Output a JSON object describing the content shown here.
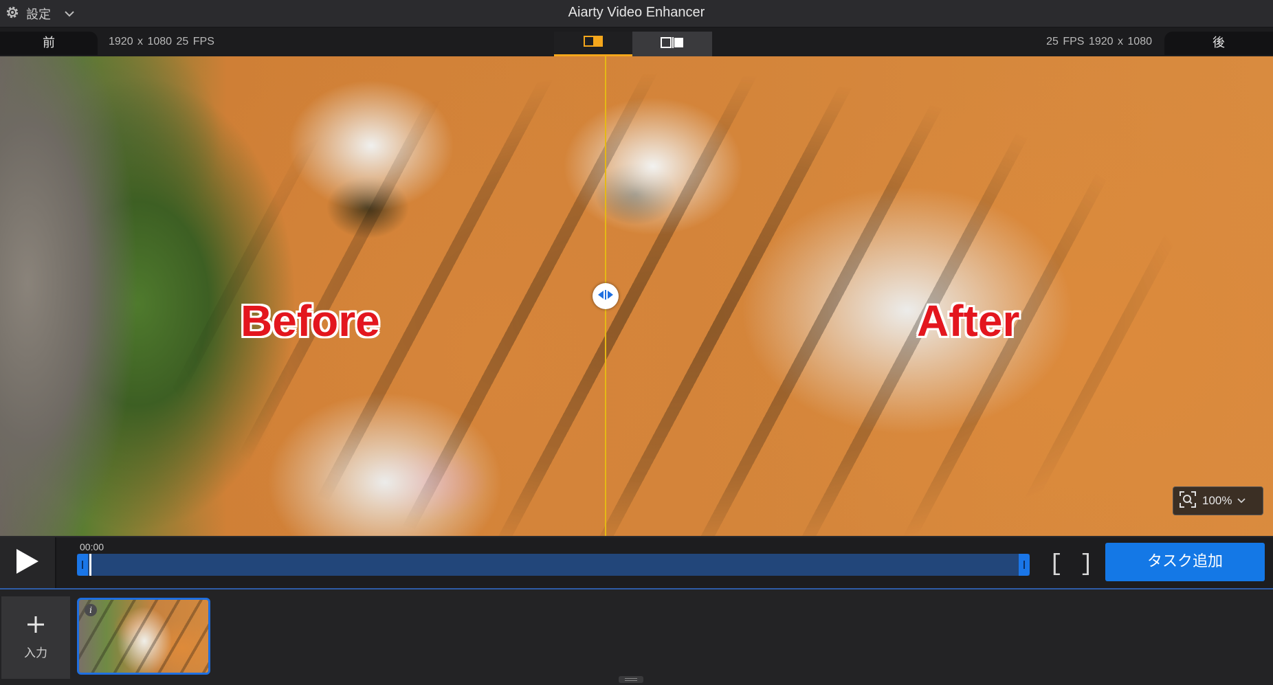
{
  "titlebar": {
    "settings_label": "設定",
    "app_title": "Aiarty Video Enhancer",
    "icons": [
      "gear-icon",
      "chevron-down-icon"
    ]
  },
  "compare": {
    "before_tag": "前",
    "after_tag": "後",
    "before_meta": "1920 x 1080  25 FPS",
    "after_meta": "25 FPS  1920 x 1080",
    "modes": [
      "split-view-icon",
      "side-by-side-view-icon"
    ],
    "active_mode": "split-view",
    "accent_color": "#f5a71c"
  },
  "viewer": {
    "before_label": "Before",
    "after_label": "After",
    "divider_color": "#e5b915",
    "zoom": "100%"
  },
  "timeline": {
    "time": "00:00",
    "start_bracket": "[",
    "end_bracket": "]",
    "add_task_label": "タスク追加",
    "accent_color": "#1478e6"
  },
  "tray": {
    "input_label": "入力",
    "info_glyph": "i"
  }
}
